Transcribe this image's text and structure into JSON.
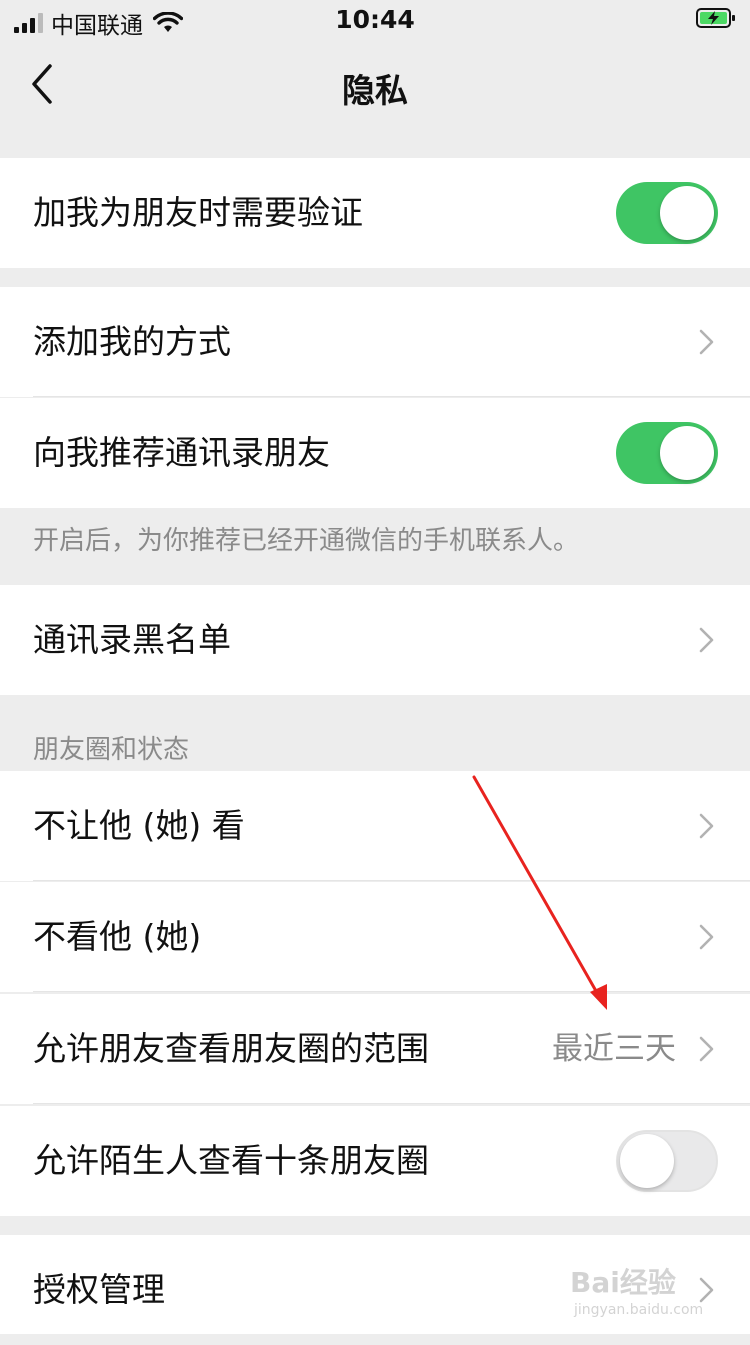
{
  "status_bar": {
    "carrier": "中国联通",
    "time": "10:44"
  },
  "nav": {
    "title": "隐私"
  },
  "settings": {
    "verify_friend": {
      "label": "加我为朋友时需要验证",
      "enabled": true
    },
    "add_me_methods": {
      "label": "添加我的方式"
    },
    "recommend_contacts": {
      "label": "向我推荐通讯录朋友",
      "enabled": true
    },
    "recommend_hint": "开启后，为你推荐已经开通微信的手机联系人。",
    "contacts_blacklist": {
      "label": "通讯录黑名单"
    }
  },
  "moments": {
    "section_title": "朋友圈和状态",
    "hide_my_posts": {
      "label": "不让他 (她) 看"
    },
    "hide_their_posts": {
      "label": "不看他 (她)"
    },
    "visible_range": {
      "label": "允许朋友查看朋友圈的范围",
      "value": "最近三天"
    },
    "stranger_ten_posts": {
      "label": "允许陌生人查看十条朋友圈",
      "enabled": false
    }
  },
  "authorization": {
    "label": "授权管理"
  },
  "watermark": {
    "brand": "Bai经验",
    "url": "jingyan.baidu.com"
  },
  "colors": {
    "toggle_on": "#3fc564",
    "background": "#ededed",
    "annotation_arrow": "#e8231f"
  }
}
